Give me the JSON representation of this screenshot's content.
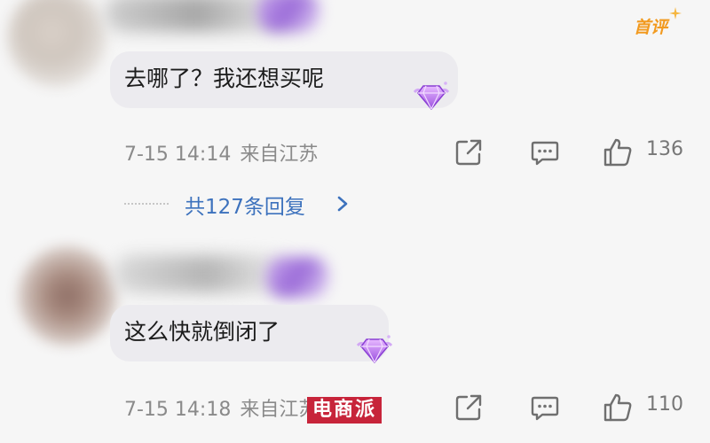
{
  "first_review_badge": {
    "label": "首评",
    "color": "#f29a1f"
  },
  "comments": [
    {
      "text": "去哪了？我还想买呢",
      "date_time": "7-15 14:14",
      "location": "来自江苏",
      "likes": "136",
      "replies_label": "共127条回复",
      "badge_icon": "purple-gem-icon"
    },
    {
      "text": "这么快就倒闭了",
      "date_time": "7-15 14:18",
      "location": "来自江苏",
      "likes": "110",
      "badge_icon": "purple-gem-icon"
    }
  ],
  "icons": {
    "share": "share-icon",
    "reply": "comment-icon",
    "like": "thumbs-up-icon",
    "chevron": "chevron-right-icon"
  },
  "watermark": {
    "text": "电商派",
    "color": "#c7243a"
  },
  "colors": {
    "background": "#f6f6f6",
    "bubble": "#ecebef",
    "meta_text": "#8a8a8a",
    "link": "#3d72bd",
    "gem": "#a35de3"
  }
}
